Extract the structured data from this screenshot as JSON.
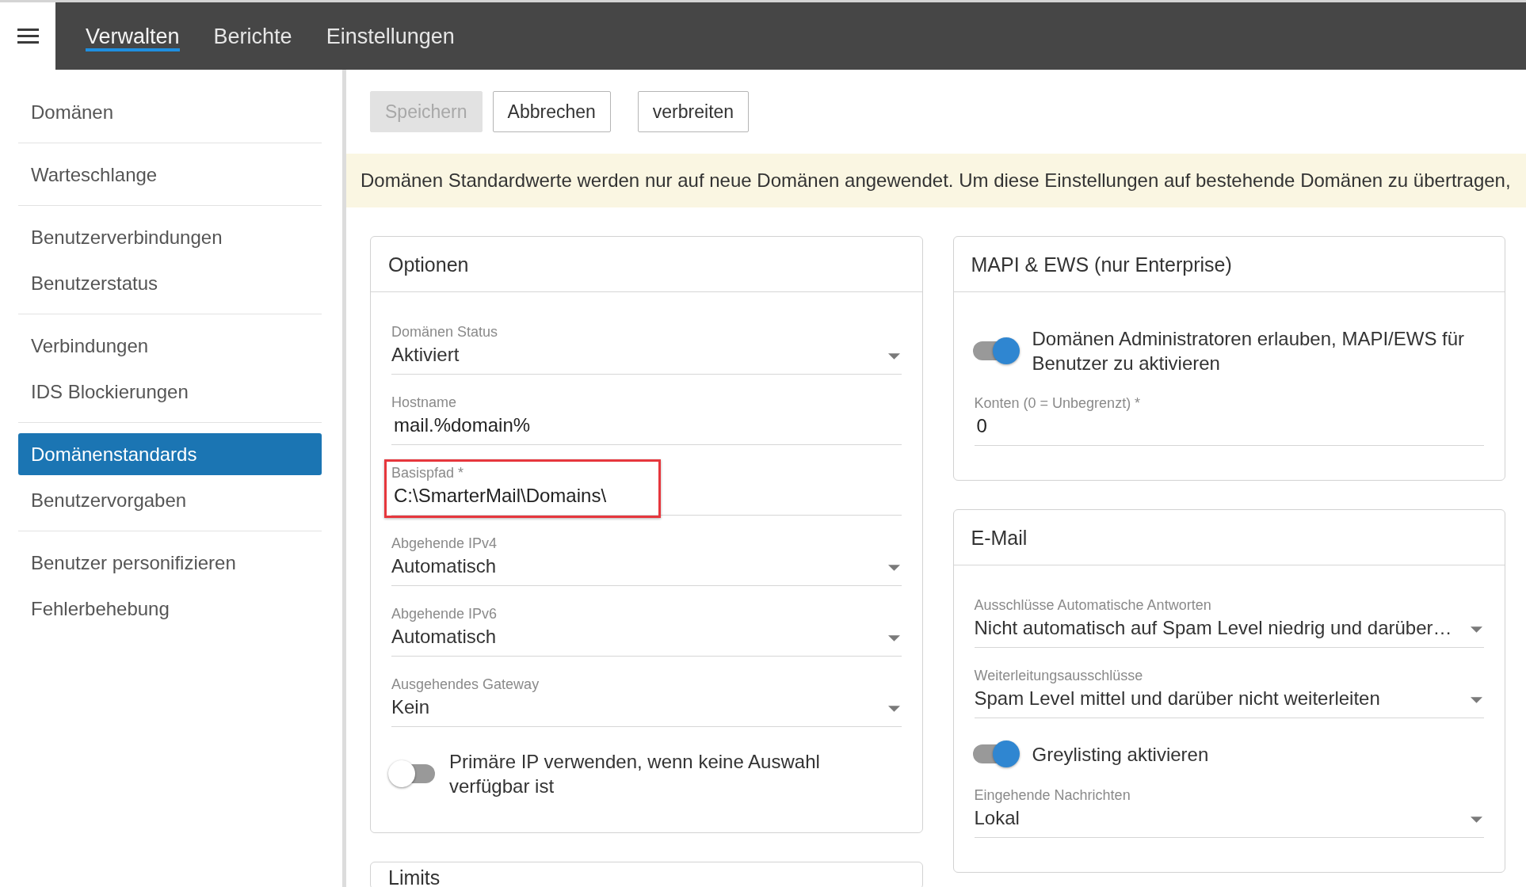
{
  "nav": {
    "tabs": [
      {
        "label": "Verwalten",
        "selected": true
      },
      {
        "label": "Berichte",
        "selected": false
      },
      {
        "label": "Einstellungen",
        "selected": false
      }
    ]
  },
  "sidebar": {
    "groups": [
      {
        "items": [
          {
            "label": "Domänen",
            "selected": false
          }
        ]
      },
      {
        "items": [
          {
            "label": "Warteschlange",
            "selected": false
          }
        ]
      },
      {
        "items": [
          {
            "label": "Benutzerverbindungen",
            "selected": false
          },
          {
            "label": "Benutzerstatus",
            "selected": false
          }
        ]
      },
      {
        "items": [
          {
            "label": "Verbindungen",
            "selected": false
          },
          {
            "label": "IDS Blockierungen",
            "selected": false
          }
        ]
      },
      {
        "items": [
          {
            "label": "Domänenstandards",
            "selected": true
          },
          {
            "label": "Benutzervorgaben",
            "selected": false
          }
        ]
      },
      {
        "items": [
          {
            "label": "Benutzer personifizieren",
            "selected": false
          },
          {
            "label": "Fehlerbehebung",
            "selected": false
          }
        ]
      }
    ]
  },
  "toolbar": {
    "groups": [
      {
        "buttons": [
          {
            "label": "Speichern",
            "disabled": true
          },
          {
            "label": "Abbrechen",
            "disabled": false
          }
        ]
      },
      {
        "buttons": [
          {
            "label": "verbreiten",
            "disabled": false
          }
        ]
      }
    ]
  },
  "notice": {
    "text": "Domänen Standardwerte werden nur auf neue Domänen angewendet. Um diese Einstellungen auf bestehende Domänen zu übertragen,"
  },
  "columns": [
    {
      "cards": [
        {
          "title": "Optionen",
          "fields": [
            {
              "kind": "select",
              "label": "Domänen Status",
              "value": "Aktiviert",
              "highlighted": false
            },
            {
              "kind": "text",
              "label": "Hostname",
              "value": "mail.%domain%",
              "highlighted": false
            },
            {
              "kind": "text",
              "label": "Basispfad *",
              "value": "C:\\SmarterMail\\Domains\\",
              "highlighted": true
            },
            {
              "kind": "select",
              "label": "Abgehende IPv4",
              "value": "Automatisch",
              "highlighted": false
            },
            {
              "kind": "select",
              "label": "Abgehende IPv6",
              "value": "Automatisch",
              "highlighted": false
            },
            {
              "kind": "select",
              "label": "Ausgehendes Gateway",
              "value": "Kein",
              "highlighted": false
            },
            {
              "kind": "toggle",
              "label": "Primäre IP verwenden, wenn keine Auswahl verfügbar ist",
              "on": false
            }
          ]
        },
        {
          "title": "Limits"
        }
      ]
    },
    {
      "cards": [
        {
          "title": "MAPI & EWS (nur Enterprise)",
          "fields": [
            {
              "kind": "toggle",
              "label": "Domänen Administratoren erlauben, MAPI/EWS für Benutzer zu aktivieren",
              "on": true
            },
            {
              "kind": "text",
              "label": "Konten (0 = Unbegrenzt) *",
              "value": "0",
              "highlighted": false
            }
          ]
        },
        {
          "title": "E-Mail",
          "fields": [
            {
              "kind": "select",
              "label": "Ausschlüsse Automatische Antworten",
              "value": "Nicht automatisch auf Spam Level niedrig und darüber…",
              "highlighted": false
            },
            {
              "kind": "select",
              "label": "Weiterleitungsausschlüsse",
              "value": "Spam Level mittel und darüber nicht weiterleiten",
              "highlighted": false
            },
            {
              "kind": "toggle",
              "label": "Greylisting aktivieren",
              "on": true
            },
            {
              "kind": "select",
              "label": "Eingehende Nachrichten",
              "value": "Lokal",
              "highlighted": false
            }
          ]
        }
      ]
    }
  ]
}
